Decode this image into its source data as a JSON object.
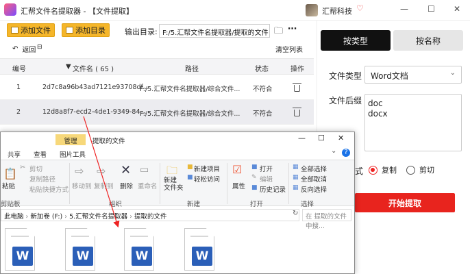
{
  "app": {
    "title": "汇帮文件名提取器 - 【文件提取】",
    "brand": "汇帮科技",
    "vip_icon": "diamond-icon"
  },
  "toolbar": {
    "add_file": "添加文件",
    "add_folder": "添加目录",
    "output_label": "输出目录:",
    "output_path": "F:/5.汇帮文件名提取器/提取的文件",
    "back": "返回",
    "clear_list": "清空列表"
  },
  "table": {
    "headers": {
      "index": "编号",
      "filename": "文件名 ( 65 )",
      "path": "路径",
      "status": "状态",
      "action": "操作"
    },
    "rows": [
      {
        "index": "1",
        "filename": "2d7c8a96b43ad7121e93708df...",
        "path": "F:/5.汇帮文件名提取器/综合文件...",
        "status": "不符合"
      },
      {
        "index": "2",
        "filename": "12d8a8f7-ecd2-4de1-9349-84...",
        "path": "F:/5.汇帮文件名提取器/综合文件...",
        "status": "不符合"
      }
    ]
  },
  "panel": {
    "tab_by_type": "按类型",
    "tab_by_name": "按名称",
    "file_type_label": "文件类型",
    "file_type_value": "Word文档",
    "suffix_label": "文件后缀",
    "suffix_value": "doc\ndocx",
    "mode_label_partial": "式",
    "mode_copy": "复制",
    "mode_cut": "剪切",
    "start_button": "开始提取"
  },
  "explorer": {
    "manage_tab": "管理",
    "title": "提取的文件",
    "ribbon_tabs": [
      "共享",
      "查看",
      "图片工具"
    ],
    "clipboard": {
      "paste": "粘贴",
      "cut": "剪切",
      "copy_path": "复制路径",
      "paste_shortcut": "粘贴快捷方式",
      "group": "剪贴板"
    },
    "organize": {
      "move_to": "移动到",
      "copy_to": "复制到",
      "delete": "删除",
      "rename": "重命名",
      "group": "组织"
    },
    "new": {
      "new_folder": "新建\n文件夹",
      "new_item": "新建项目",
      "easy_access": "轻松访问",
      "group": "新建"
    },
    "open": {
      "properties": "属性",
      "open": "打开",
      "edit": "编辑",
      "history": "历史记录",
      "group": "打开"
    },
    "select": {
      "select_all": "全部选择",
      "select_none": "全部取消",
      "invert": "反向选择",
      "group": "选择"
    },
    "address": [
      "此电脑",
      "新加卷 (F:)",
      "5.汇帮文件名提取器",
      "提取的文件"
    ],
    "search_placeholder": "在 提取的文件 中搜...",
    "file_icon_letter": "W"
  },
  "colors": {
    "accent_red": "#e8241e",
    "yellow_button": "#f5b62a",
    "word_blue": "#2b5fb8"
  }
}
